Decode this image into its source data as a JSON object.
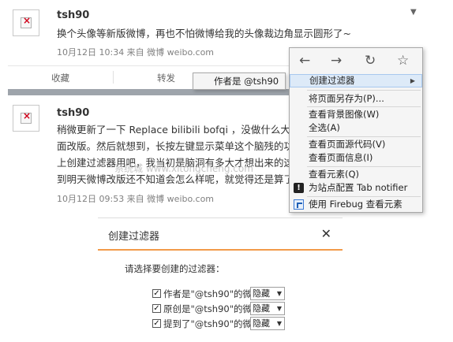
{
  "posts": [
    {
      "username": "tsh90",
      "text_lines": [
        "换个头像等新版微博，再也不怕微博给我的头像裁边角显示圆形了~"
      ],
      "meta": "10月12日 10:34 来自 微博 weibo.com"
    },
    {
      "username": "tsh90",
      "text_lines": [
        "稍微更新了一下 Replace bilibili bofqi ，没做什么大的",
        "面改版。然后就想到，长按左键显示菜单这个脑残的功",
        "上创建过滤器用吧，我当初是脑洞有多大才想出来的这",
        "到明天微博改版还不知道会怎么样呢，就觉得还是算了"
      ],
      "meta": "10月12日 09:53 来自 微博 weibo.com"
    }
  ],
  "actions": {
    "favorite": "收藏",
    "repost": "转发"
  },
  "expand_icon": "chevron-down-icon",
  "watermark": "系统城 www.xitongcheng.com",
  "context_menu": {
    "nav": {
      "back": "←",
      "forward": "→",
      "reload": "↻",
      "bookmark": "☆"
    },
    "items": {
      "create_filter": "创建过滤器",
      "save_page_as": "将页面另存为(P)...",
      "view_background": "查看背景图像(W)",
      "select_all": "全选(A)",
      "view_source": "查看页面源代码(V)",
      "view_page_info": "查看页面信息(I)",
      "inspect_element": "查看元素(Q)",
      "tab_notifier": "为站点配置 Tab notifier",
      "firebug_inspect": "使用 Firebug 查看元素"
    },
    "submenu_item": "作者是 @tsh90"
  },
  "dialog": {
    "title": "创建过滤器",
    "close": "✕",
    "prompt": "请选择要创建的过滤器：",
    "options": [
      {
        "label": "作者是\"@tsh90\"的微博",
        "checked": "✓",
        "select": "隐藏"
      },
      {
        "label": "原创是\"@tsh90\"的微博",
        "checked": "✓",
        "select": "隐藏"
      },
      {
        "label": "提到了\"@tsh90\"的微博",
        "checked": "✓",
        "select": "隐藏"
      }
    ]
  },
  "colors": {
    "accent_orange": "#f29a49",
    "menu_highlight": "#ddeaf8",
    "feed_gap": "#9ea4ab"
  }
}
